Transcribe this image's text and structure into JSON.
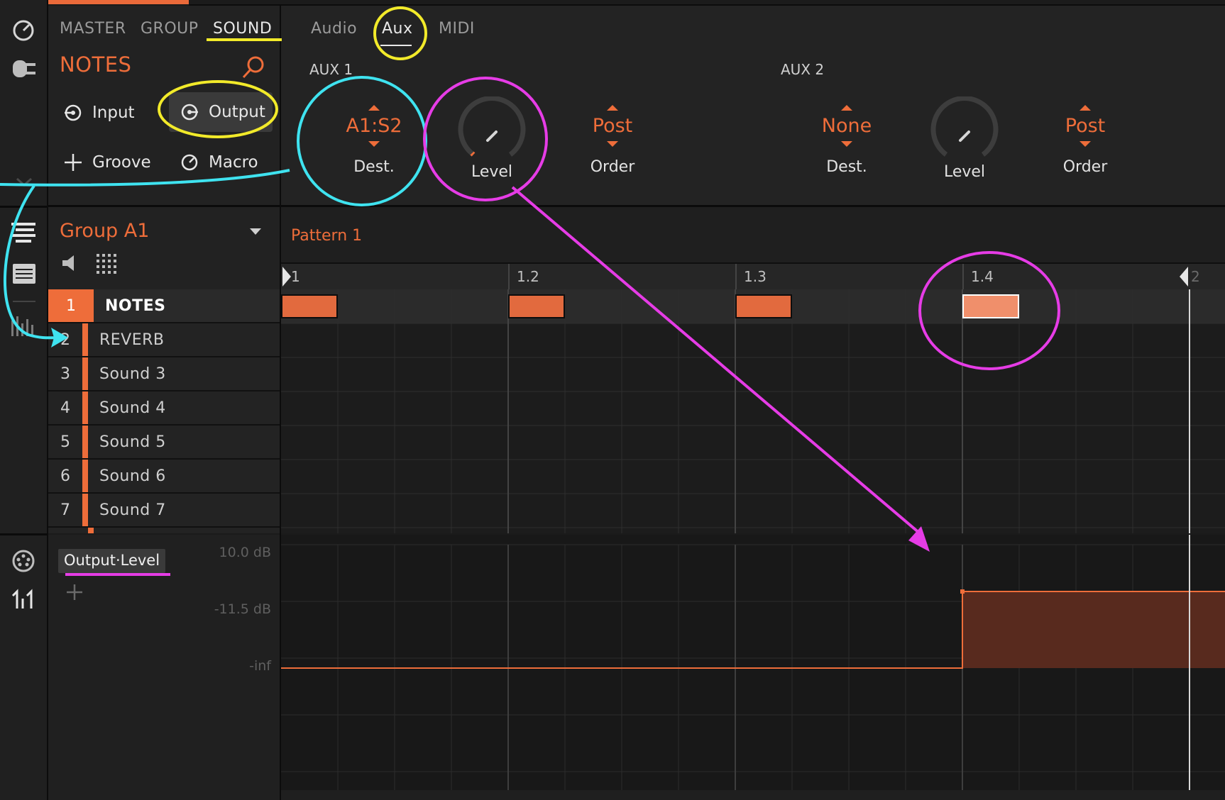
{
  "colors": {
    "accent": "#ee6d3a",
    "annotation_cyan": "#3fe3f0",
    "annotation_yellow": "#f2ea2a",
    "annotation_magenta": "#e63ce6"
  },
  "icons": {
    "browser": "knob-icon",
    "plugin": "plug-icon",
    "arrange": "lines-icon",
    "list": "list-icon",
    "mixer": "bars-icon",
    "midi": "midi-port-icon",
    "routing": "routing-icon"
  },
  "top_tabs": [
    "MASTER",
    "GROUP",
    "SOUND"
  ],
  "notes_title": "NOTES",
  "channel_buttons": {
    "input": "Input",
    "output": "Output",
    "groove": "Groove",
    "macro": "Macro"
  },
  "output_tabs": [
    "Audio",
    "Aux",
    "MIDI"
  ],
  "aux1": {
    "title": "AUX 1",
    "dest_value": "A1:S2",
    "dest_label": "Dest.",
    "level_label": "Level",
    "order_value": "Post",
    "order_label": "Order"
  },
  "aux2": {
    "title": "AUX 2",
    "dest_value": "None",
    "dest_label": "Dest.",
    "level_label": "Level",
    "order_value": "Post",
    "order_label": "Order"
  },
  "group": {
    "name": "Group A1",
    "sounds": [
      {
        "num": "1",
        "name": "NOTES"
      },
      {
        "num": "2",
        "name": "REVERB"
      },
      {
        "num": "3",
        "name": "Sound 3"
      },
      {
        "num": "4",
        "name": "Sound 4"
      },
      {
        "num": "5",
        "name": "Sound 5"
      },
      {
        "num": "6",
        "name": "Sound 6"
      },
      {
        "num": "7",
        "name": "Sound 7"
      }
    ]
  },
  "pattern": {
    "name": "Pattern 1",
    "ruler": [
      "1",
      "1.2",
      "1.3",
      "1.4",
      "2"
    ]
  },
  "automation": {
    "parameter": "Output·Level",
    "db_labels": [
      "10.0 dB",
      "-11.5 dB",
      "-inf"
    ]
  }
}
